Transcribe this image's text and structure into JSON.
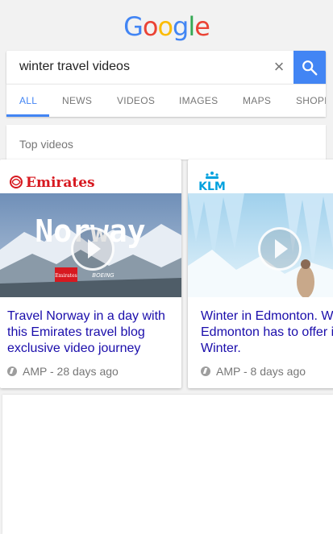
{
  "logo": {
    "text": "Google"
  },
  "search": {
    "value": "winter travel videos",
    "clear_icon": "×"
  },
  "tabs": [
    {
      "label": "ALL"
    },
    {
      "label": "NEWS"
    },
    {
      "label": "VIDEOS"
    },
    {
      "label": "IMAGES"
    },
    {
      "label": "MAPS"
    },
    {
      "label": "SHOPPING"
    }
  ],
  "section": {
    "title": "Top videos"
  },
  "cards": [
    {
      "brand": "Emirates",
      "thumb_text": "Norway",
      "title": "Travel Norway in a day with this Emirates travel blog exclusive video journey",
      "meta": "AMP - 28 days ago"
    },
    {
      "brand": "KLM",
      "title": "Winter in Edmonton. What Edmonton has to offer in Winter.",
      "meta": "AMP - 8 days ago"
    }
  ],
  "colors": {
    "accent": "#4285f4",
    "link": "#1a0dab",
    "emirates_red": "#d71920",
    "klm_blue": "#00a1de"
  }
}
